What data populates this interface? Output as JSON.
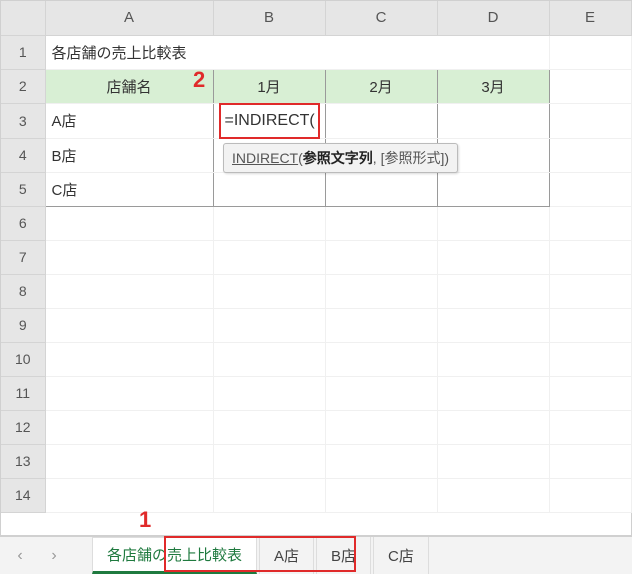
{
  "columns": [
    "A",
    "B",
    "C",
    "D",
    "E"
  ],
  "rows": [
    "1",
    "2",
    "3",
    "4",
    "5",
    "6",
    "7",
    "8",
    "9",
    "10",
    "11",
    "12",
    "13",
    "14"
  ],
  "title_cell": "各店舗の売上比較表",
  "header_row": {
    "store": "店舗名",
    "m1": "1月",
    "m2": "2月",
    "m3": "3月"
  },
  "stores": {
    "a": "A店",
    "b": "B店",
    "c": "C店"
  },
  "formula": "=INDIRECT(",
  "tooltip": {
    "fn": "INDIRECT",
    "arg1": "参照文字列",
    "arg2": "[参照形式]"
  },
  "annot": {
    "n1": "1",
    "n2": "2"
  },
  "tabs": {
    "active": "各店舗の売上比較表",
    "t2": "A店",
    "t3": "B店",
    "t4": "C店"
  },
  "chart_data": {
    "type": "table",
    "title": "各店舗の売上比較表",
    "columns": [
      "店舗名",
      "1月",
      "2月",
      "3月"
    ],
    "rows": [
      {
        "店舗名": "A店",
        "1月": "=INDIRECT(",
        "2月": "",
        "3月": ""
      },
      {
        "店舗名": "B店",
        "1月": "",
        "2月": "",
        "3月": ""
      },
      {
        "店舗名": "C店",
        "1月": "",
        "2月": "",
        "3月": ""
      }
    ]
  }
}
